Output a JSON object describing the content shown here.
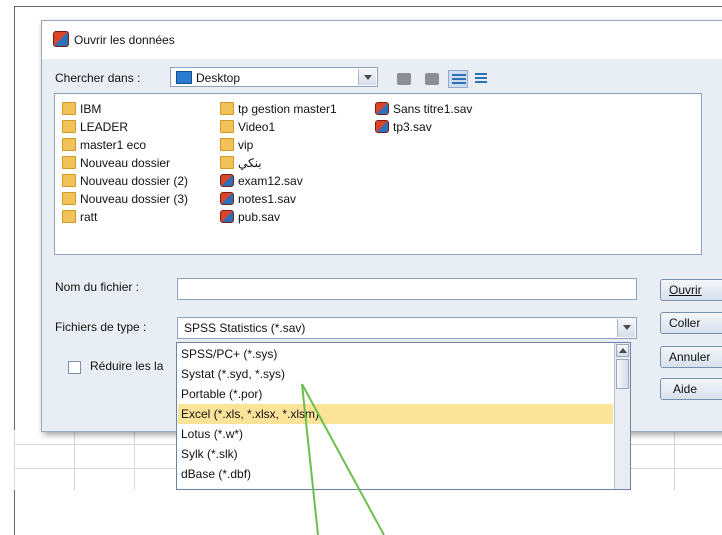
{
  "dialog": {
    "title": "Ouvrir les données",
    "look_in_label": "Chercher dans :",
    "look_in_value": "Desktop",
    "filename_label": "Nom du fichier :",
    "filename_value": "",
    "filetype_label": "Fichiers de type :",
    "filetype_value": "SPSS Statistics (*.sav)",
    "minimize_label": "Réduire les la"
  },
  "files": {
    "col1": [
      {
        "name": "IBM",
        "icon": "folder-icon"
      },
      {
        "name": "LEADER",
        "icon": "folder-icon"
      },
      {
        "name": "master1 eco",
        "icon": "folder-icon"
      },
      {
        "name": "Nouveau dossier",
        "icon": "folder-icon"
      },
      {
        "name": "Nouveau dossier (2)",
        "icon": "folder-icon"
      },
      {
        "name": "Nouveau dossier (3)",
        "icon": "folder-icon"
      },
      {
        "name": "ratt",
        "icon": "folder-icon"
      }
    ],
    "col2": [
      {
        "name": "tp gestion master1",
        "icon": "folder-icon"
      },
      {
        "name": "Video1",
        "icon": "folder-icon"
      },
      {
        "name": "vip",
        "icon": "folder-icon"
      },
      {
        "name": "بنكي",
        "icon": "folder-icon"
      },
      {
        "name": "exam12.sav",
        "icon": "sav-file-icon"
      },
      {
        "name": "notes1.sav",
        "icon": "sav-file-icon"
      },
      {
        "name": "pub.sav",
        "icon": "sav-file-icon"
      }
    ],
    "col3": [
      {
        "name": "Sans titre1.sav",
        "icon": "sav-file-icon"
      },
      {
        "name": "tp3.sav",
        "icon": "sav-file-icon"
      }
    ]
  },
  "buttons": {
    "open": "Ouvrir",
    "paste": "Coller",
    "cancel": "Annuler",
    "help": "Aide"
  },
  "dropdown_options": [
    "SPSS/PC+ (*.sys)",
    "Systat (*.syd, *.sys)",
    "Portable (*.por)",
    "Excel (*.xls, *.xlsx, *.xlsm)",
    "Lotus (*.w*)",
    "Sylk (*.slk)",
    "dBase (*.dbf)"
  ],
  "selected_option_index": 3,
  "colors": {
    "accent_selection": "#fbe39a",
    "dialog_bg": "#e9eef5",
    "annotation_arrow": "#6cbf4a"
  }
}
